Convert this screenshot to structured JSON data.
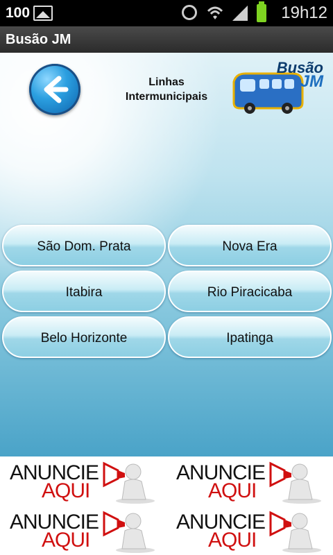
{
  "status_bar": {
    "battery_level_text": "100",
    "time": "19h12"
  },
  "app": {
    "title": "Busão JM"
  },
  "header": {
    "title_line1": "Linhas",
    "title_line2": "Intermunicipais",
    "logo_line1": "Busão",
    "logo_line2": "JM"
  },
  "cities": [
    {
      "label": "São Dom. Prata"
    },
    {
      "label": "Nova Era"
    },
    {
      "label": "Itabira"
    },
    {
      "label": "Rio Piracicaba"
    },
    {
      "label": "Belo Horizonte"
    },
    {
      "label": "Ipatinga"
    }
  ],
  "ads": [
    {
      "line1": "ANUNCIE",
      "line2": "AQUI"
    },
    {
      "line1": "ANUNCIE",
      "line2": "AQUI"
    },
    {
      "line1": "ANUNCIE",
      "line2": "AQUI"
    },
    {
      "line1": "ANUNCIE",
      "line2": "AQUI"
    }
  ],
  "icons": {
    "back": "arrow-left-icon",
    "gallery": "image-icon",
    "alarm": "alarm-icon",
    "wifi": "wifi-icon",
    "signal": "signal-icon",
    "battery": "battery-icon",
    "megaphone": "megaphone-icon"
  },
  "colors": {
    "status_bar_bg": "#000000",
    "title_bar_bg": "#3a3a3a",
    "back_button": "#2b9fe0",
    "ad_accent": "#d01010"
  }
}
